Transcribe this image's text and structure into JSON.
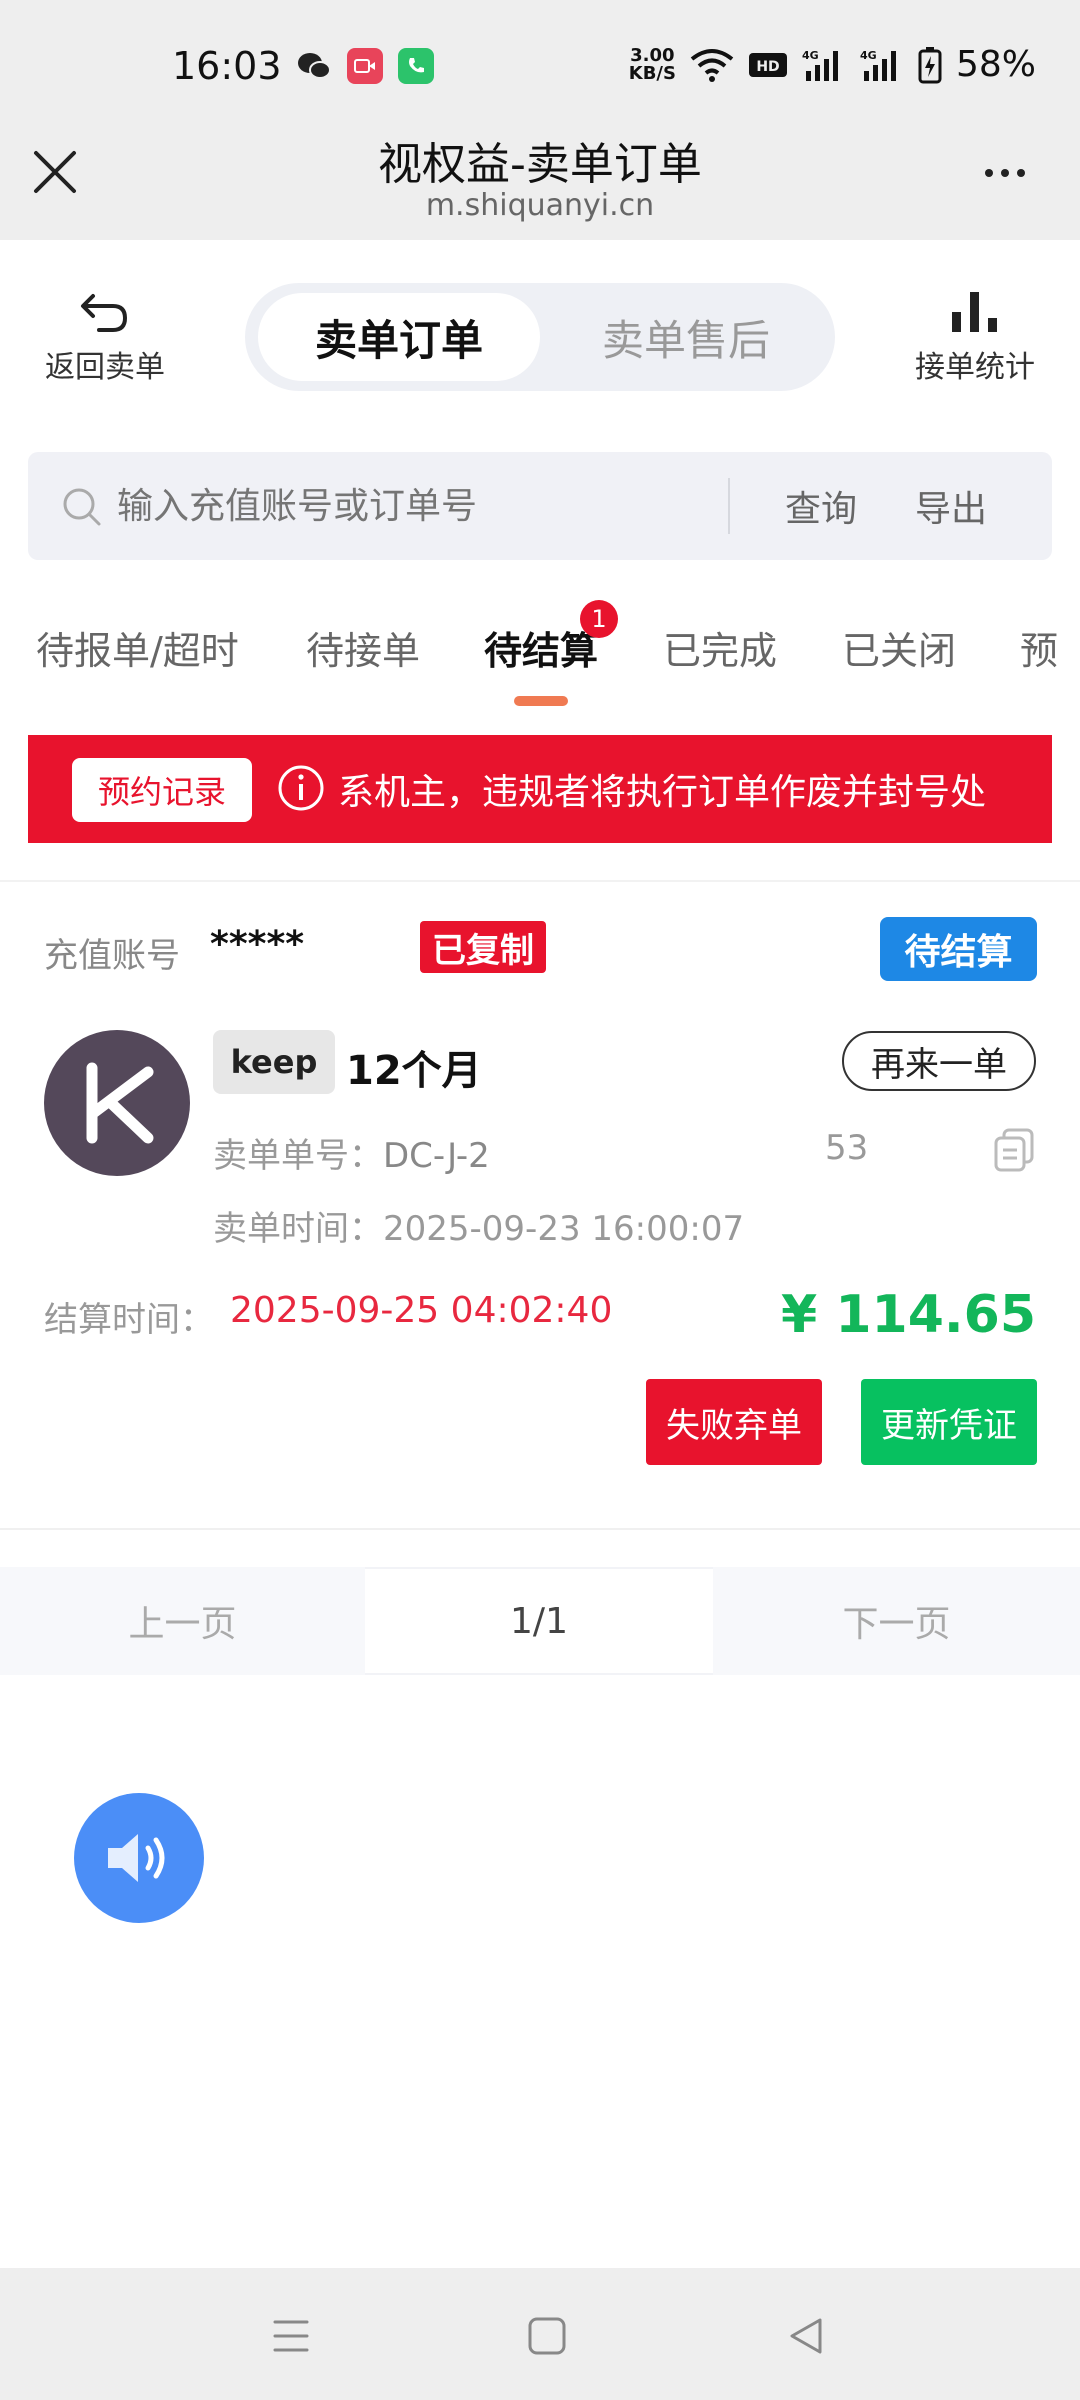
{
  "status_bar": {
    "time": "16:03",
    "speed_top": "3.00",
    "speed_bottom": "KB/S",
    "battery": "58%",
    "icons": [
      "wechat-icon",
      "video-call-icon",
      "phone-icon",
      "wifi-icon",
      "hd-icon",
      "signal-4g-icon",
      "signal-4g-icon",
      "battery-charging-icon"
    ]
  },
  "browser": {
    "title": "视权益-卖单订单",
    "url": "m.shiquanyi.cn"
  },
  "toolbar": {
    "back_label": "返回卖单",
    "segment_active": "卖单订单",
    "segment_inactive": "卖单售后",
    "stats_label": "接单统计"
  },
  "search": {
    "placeholder": "输入充值账号或订单号",
    "query_label": "查询",
    "export_label": "导出"
  },
  "tabs": [
    {
      "label": "待报单/超时"
    },
    {
      "label": "待接单"
    },
    {
      "label": "待结算",
      "badge": "1"
    },
    {
      "label": "已完成"
    },
    {
      "label": "已关闭"
    },
    {
      "label": "预"
    }
  ],
  "notice": {
    "button_label": "预约记录",
    "text": "系机主，违规者将执行订单作废并封号处"
  },
  "order": {
    "account_label": "充值账号",
    "account_value": "*****",
    "copied_tag": "已复制",
    "status_tag": "待结算",
    "brand": "keep",
    "product": "12个月",
    "reorder_label": "再来一单",
    "order_no_label": "卖单单号：",
    "order_no_value": "DC-J-2",
    "order_no_suffix": "53",
    "sell_time_label": "卖单时间：",
    "sell_time_value": "2025-09-23 16:00:07",
    "settle_label": "结算时间：",
    "settle_value": "2025-09-25 04:02:40",
    "amount": "¥ 114.65",
    "fail_label": "失败弃单",
    "update_label": "更新凭证",
    "colors": {
      "amount": "#13b65a",
      "fail": "#e8132d",
      "update": "#07c160",
      "status": "#1e88e5"
    }
  },
  "pagination": {
    "prev_label": "上一页",
    "page": "1/1",
    "next_label": "下一页"
  }
}
